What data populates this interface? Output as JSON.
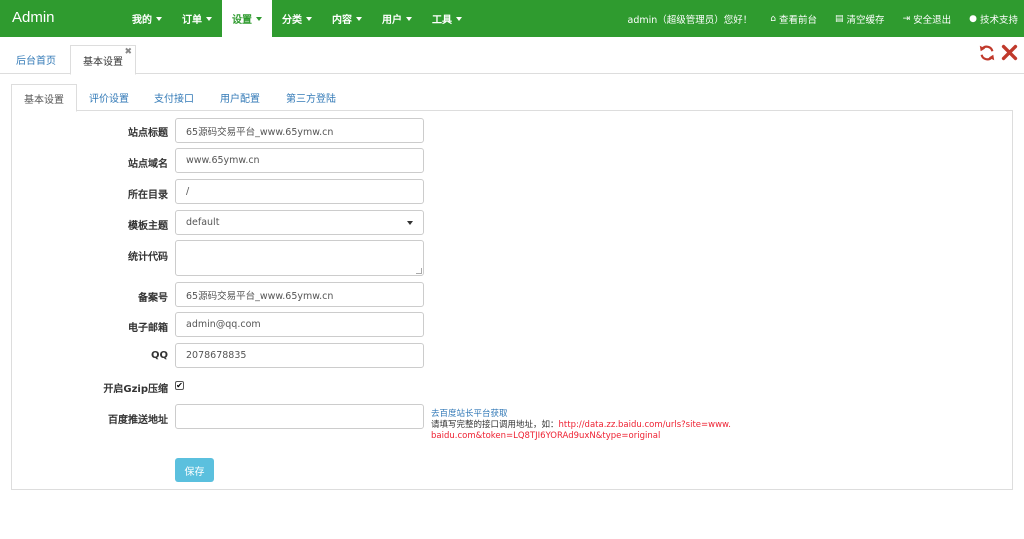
{
  "navbar": {
    "brand": "Admin",
    "menu": [
      {
        "label": "我的"
      },
      {
        "label": "订单"
      },
      {
        "label": "设置"
      },
      {
        "label": "分类"
      },
      {
        "label": "内容"
      },
      {
        "label": "用户"
      },
      {
        "label": "工具"
      }
    ],
    "active_menu": "设置",
    "greeting": "admin（超级管理员）您好！",
    "view_front": "查看前台",
    "clear_cache": "清空缓存",
    "logout": "安全退出",
    "support": "技术支持",
    "bg_color": "#2f9b2f"
  },
  "page_tabs": {
    "home": "后台首页",
    "current": "基本设置"
  },
  "inner_tabs": [
    "基本设置",
    "评价设置",
    "支付接口",
    "用户配置",
    "第三方登陆"
  ],
  "form": {
    "site_title": {
      "label": "站点标题",
      "value": "65源码交易平台_www.65ymw.cn"
    },
    "site_domain": {
      "label": "站点域名",
      "value": "www.65ymw.cn"
    },
    "directory": {
      "label": "所在目录",
      "value": "/"
    },
    "template": {
      "label": "模板主题",
      "value": "default"
    },
    "stats_code": {
      "label": "统计代码",
      "value": ""
    },
    "icp": {
      "label": "备案号",
      "value": "65源码交易平台_www.65ymw.cn"
    },
    "email": {
      "label": "电子邮箱",
      "value": "admin@qq.com"
    },
    "qq": {
      "label": "QQ",
      "value": "2078678835"
    },
    "gzip": {
      "label": "开启Gzip压缩",
      "checked": true
    },
    "baidu_push": {
      "label": "百度推送地址",
      "value": ""
    }
  },
  "help": {
    "link": "去百度站长平台获取",
    "line": "请填写完整的接口调用地址，如：",
    "example": "http://data.zz.baidu.com/urls?site=www.baidu.com&token=LQ8TJI6YORAd9uxN&type=original"
  },
  "save_label": "保存"
}
